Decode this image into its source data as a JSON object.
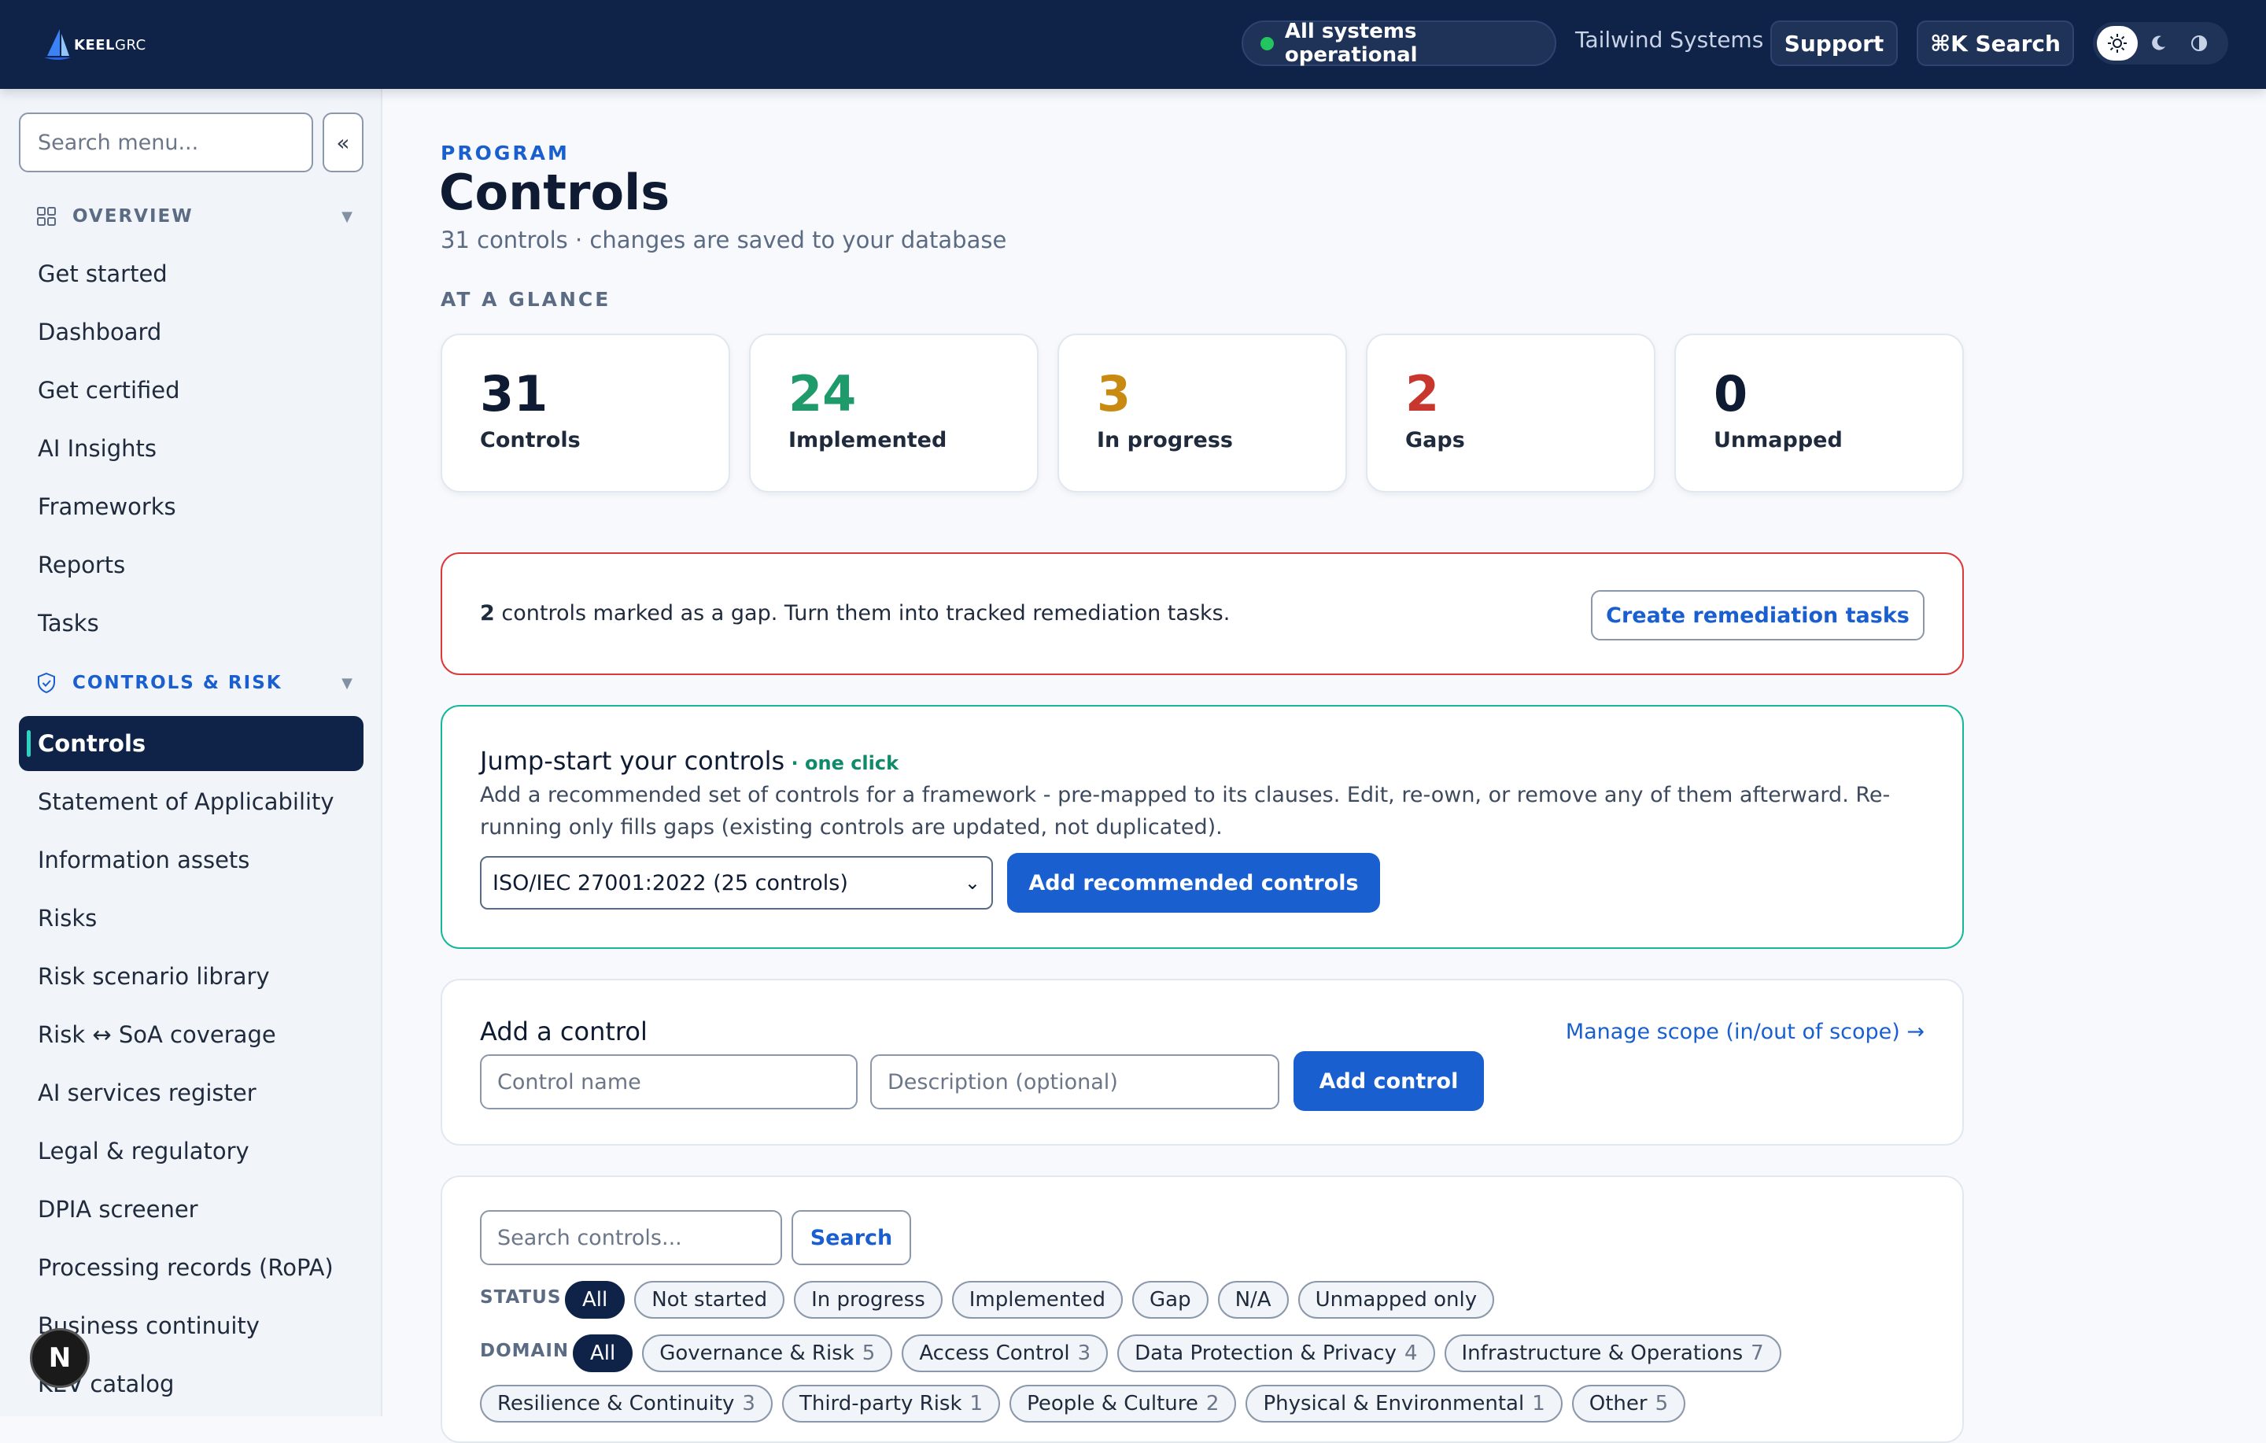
{
  "brand": {
    "name_bold": "KEEL",
    "name_light": "GRC"
  },
  "topbar": {
    "status": "All systems operational",
    "org": "Tailwind Systems",
    "support_label": "Support",
    "search_label": "⌘K Search",
    "theme_options": [
      "light",
      "dark",
      "system"
    ]
  },
  "sidebar": {
    "search_placeholder": "Search menu...",
    "collapse_label": "«",
    "sections": {
      "overview": "OVERVIEW",
      "controls_risk": "CONTROLS & RISK"
    },
    "overview_items": [
      "Get started",
      "Dashboard",
      "Get certified",
      "AI Insights",
      "Frameworks",
      "Reports",
      "Tasks"
    ],
    "controls_items": [
      "Controls",
      "Statement of Applicability",
      "Information assets",
      "Risks",
      "Risk scenario library",
      "Risk ↔ SoA coverage",
      "AI services register",
      "Legal & regulatory",
      "DPIA screener",
      "Processing records (RoPA)",
      "Business continuity",
      "KEV catalog"
    ],
    "active_item": "Controls",
    "fab_label": "N"
  },
  "page": {
    "eyebrow": "PROGRAM",
    "title": "Controls",
    "subtitle": "31 controls · changes are saved to your database",
    "glance_label": "AT A GLANCE"
  },
  "stats": [
    {
      "value": "31",
      "label": "Controls",
      "color": "#0f1b33"
    },
    {
      "value": "24",
      "label": "Implemented",
      "color": "#1f9a6a"
    },
    {
      "value": "3",
      "label": "In progress",
      "color": "#c98a12"
    },
    {
      "value": "2",
      "label": "Gaps",
      "color": "#c8372d"
    },
    {
      "value": "0",
      "label": "Unmapped",
      "color": "#0f1b33"
    }
  ],
  "gap_banner": {
    "count": "2",
    "text": " controls marked as a gap. Turn them into tracked remediation tasks.",
    "button": "Create remediation tasks"
  },
  "jumpstart": {
    "title": "Jump-start your controls",
    "tag": " · one click",
    "description": "Add a recommended set of controls for a framework - pre-mapped to its clauses. Edit, re-own, or remove any of them afterward. Re-running only fills gaps (existing controls are updated, not duplicated).",
    "selected_framework": "ISO/IEC 27001:2022 (25 controls)",
    "button": "Add recommended controls"
  },
  "add_control": {
    "title": "Add a control",
    "scope_link": "Manage scope (in/out of scope) →",
    "name_placeholder": "Control name",
    "desc_placeholder": "Description (optional)",
    "button": "Add control"
  },
  "list": {
    "search_placeholder": "Search controls...",
    "search_button": "Search",
    "status_label": "STATUS",
    "status_chips": [
      "All",
      "Not started",
      "In progress",
      "Implemented",
      "Gap",
      "N/A",
      "Unmapped only"
    ],
    "domain_label": "DOMAIN",
    "domain_chips": [
      {
        "label": "All",
        "count": ""
      },
      {
        "label": "Governance & Risk",
        "count": "5"
      },
      {
        "label": "Access Control",
        "count": "3"
      },
      {
        "label": "Data Protection & Privacy",
        "count": "4"
      },
      {
        "label": "Infrastructure & Operations",
        "count": "7"
      }
    ],
    "domain_chips_row2": [
      {
        "label": "Resilience & Continuity",
        "count": "3"
      },
      {
        "label": "Third-party Risk",
        "count": "1"
      },
      {
        "label": "People & Culture",
        "count": "2"
      },
      {
        "label": "Physical & Environmental",
        "count": "1"
      },
      {
        "label": "Other",
        "count": "5"
      }
    ]
  }
}
